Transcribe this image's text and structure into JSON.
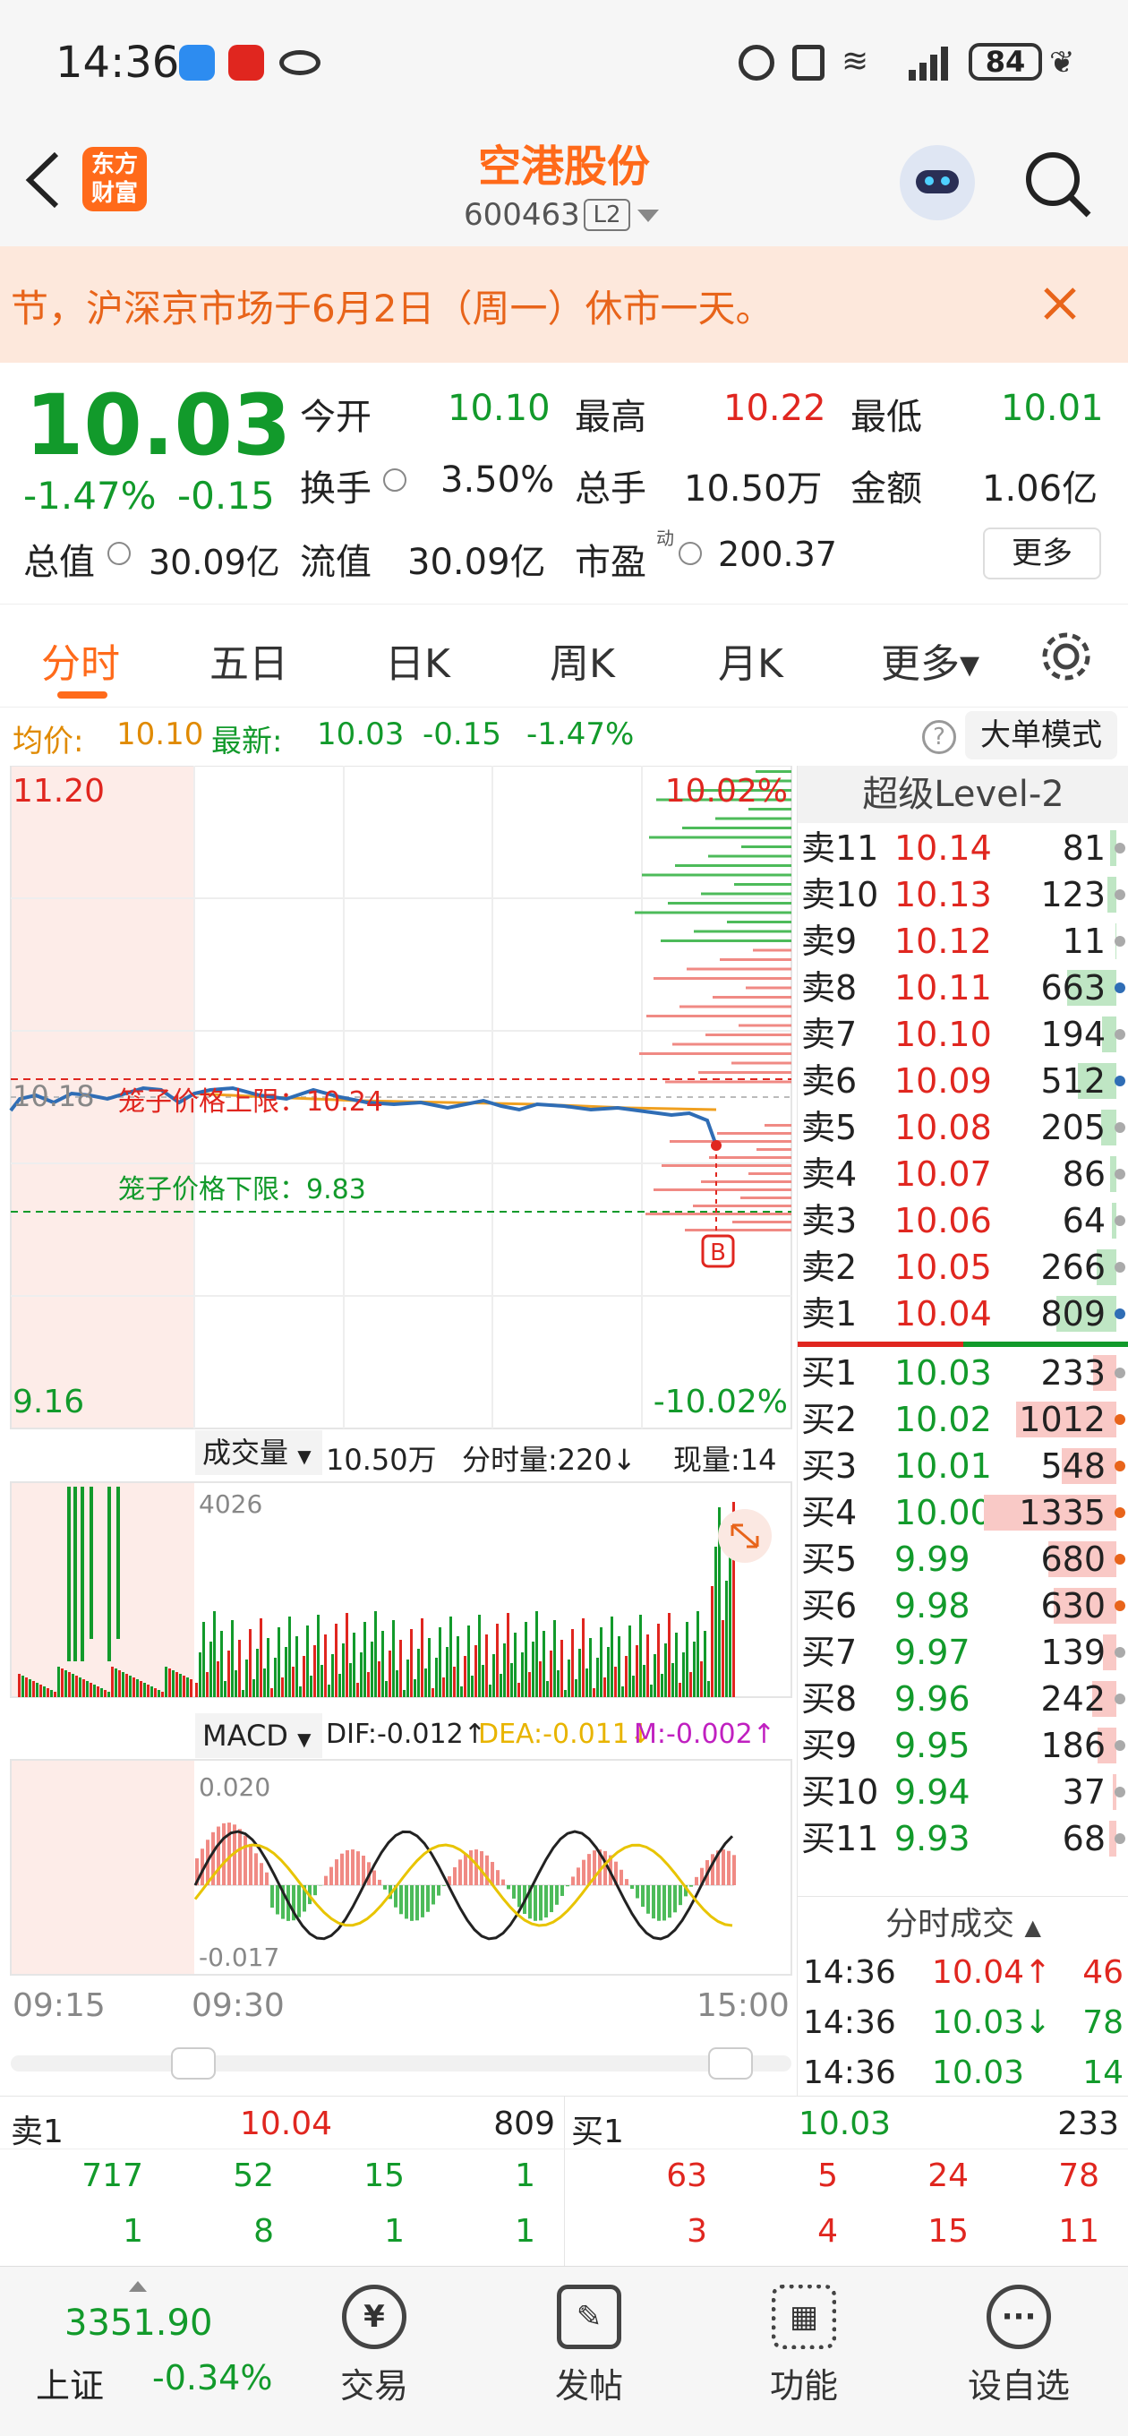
{
  "status_bar": {
    "time": "14:36",
    "battery": "84"
  },
  "header": {
    "title": "空港股份",
    "code": "600463",
    "level_badge": "L2",
    "logo_line1": "东方",
    "logo_line2": "财富"
  },
  "notice": {
    "text": "节，沪深京市场于6月2日（周一）休市一天。"
  },
  "quote": {
    "price": "10.03",
    "change_pct": "-1.47%",
    "change": "-0.15",
    "open_label": "今开",
    "open": "10.10",
    "high_label": "最高",
    "high": "10.22",
    "low_label": "最低",
    "low": "10.01",
    "turnover_label": "换手",
    "turnover": "3.50%",
    "volume_label": "总手",
    "volume": "10.50万",
    "amount_label": "金额",
    "amount": "1.06亿",
    "mktcap_label": "总值",
    "mktcap": "30.09亿",
    "float_label": "流值",
    "float": "30.09亿",
    "pe_label": "市盈",
    "pe_sup": "动",
    "pe": "200.37",
    "more_button": "更多"
  },
  "tabs": [
    "分时",
    "五日",
    "日K",
    "周K",
    "月K",
    "更多▾"
  ],
  "price_line": {
    "avg_label": "均价:",
    "avg": "10.10",
    "latest_label": "最新:",
    "latest": "10.03",
    "change": "-0.15",
    "pct": "-1.47%",
    "mode_button": "大单模式"
  },
  "chart": {
    "y_max": "11.20",
    "y_min": "9.16",
    "pct_max": "10.02%",
    "pct_min": "-10.02%",
    "prev_close": "10.18",
    "upper_limit": "笼子价格上限：10.24",
    "lower_limit": "笼子价格下限：9.83",
    "marker": "B",
    "vol_label": "成交量",
    "vol_total": "10.50万",
    "vol_min": "分时量:220↓",
    "vol_now": "现量:14",
    "vol_max": "4026",
    "macd_label": "MACD",
    "dif": "DIF:-0.012↑",
    "dea": "DEA:-0.011↓",
    "m": "M:-0.002↑",
    "macd_top": "0.020",
    "macd_bot": "-0.017",
    "time_start": "09:15",
    "time_open": "09:30",
    "time_end": "15:00",
    "colors": {
      "price_line": "#2f6db5",
      "avg_line": "#f0a020",
      "up": "#e0261f",
      "down": "#129a2b"
    }
  },
  "orderbook": {
    "title": "超级Level-2",
    "asks": [
      {
        "label": "卖11",
        "price": "10.14",
        "vol": "81"
      },
      {
        "label": "卖10",
        "price": "10.13",
        "vol": "123"
      },
      {
        "label": "卖9",
        "price": "10.12",
        "vol": "11"
      },
      {
        "label": "卖8",
        "price": "10.11",
        "vol": "663"
      },
      {
        "label": "卖7",
        "price": "10.10",
        "vol": "194"
      },
      {
        "label": "卖6",
        "price": "10.09",
        "vol": "512"
      },
      {
        "label": "卖5",
        "price": "10.08",
        "vol": "205"
      },
      {
        "label": "卖4",
        "price": "10.07",
        "vol": "86"
      },
      {
        "label": "卖3",
        "price": "10.06",
        "vol": "64"
      },
      {
        "label": "卖2",
        "price": "10.05",
        "vol": "266"
      },
      {
        "label": "卖1",
        "price": "10.04",
        "vol": "809"
      }
    ],
    "bids": [
      {
        "label": "买1",
        "price": "10.03",
        "vol": "233"
      },
      {
        "label": "买2",
        "price": "10.02",
        "vol": "1012"
      },
      {
        "label": "买3",
        "price": "10.01",
        "vol": "548"
      },
      {
        "label": "买4",
        "price": "10.00",
        "vol": "1335"
      },
      {
        "label": "买5",
        "price": "9.99",
        "vol": "680"
      },
      {
        "label": "买6",
        "price": "9.98",
        "vol": "630"
      },
      {
        "label": "买7",
        "price": "9.97",
        "vol": "139"
      },
      {
        "label": "买8",
        "price": "9.96",
        "vol": "242"
      },
      {
        "label": "买9",
        "price": "9.95",
        "vol": "186"
      },
      {
        "label": "买10",
        "price": "9.94",
        "vol": "37"
      },
      {
        "label": "买11",
        "price": "9.93",
        "vol": "68"
      }
    ],
    "trades_title": "分时成交",
    "trades": [
      {
        "time": "14:36",
        "price": "10.04↑",
        "vol": "46"
      },
      {
        "time": "14:36",
        "price": "10.03↓",
        "vol": "78"
      },
      {
        "time": "14:36",
        "price": "10.03",
        "vol": "14"
      }
    ]
  },
  "queue": {
    "ask_label": "卖1",
    "ask_price": "10.04",
    "ask_vol": "809",
    "bid_label": "买1",
    "bid_price": "10.03",
    "bid_vol": "233",
    "ask_row1": [
      "717",
      "52",
      "15",
      "1"
    ],
    "ask_row2": [
      "1",
      "8",
      "1",
      "1"
    ],
    "bid_row1": [
      "63",
      "5",
      "24",
      "78"
    ],
    "bid_row2": [
      "3",
      "4",
      "15",
      "11"
    ]
  },
  "bottom_nav": {
    "index_value": "3351.90",
    "index_name": "上证",
    "index_change": "-0.34%",
    "items": [
      "交易",
      "发帖",
      "功能",
      "设自选"
    ]
  }
}
